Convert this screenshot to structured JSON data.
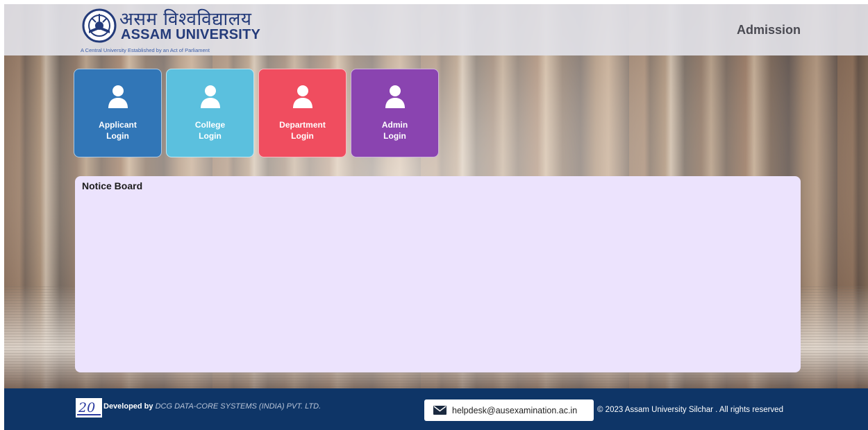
{
  "header": {
    "logo_hindi": "असम विश्वविद्यालय",
    "logo_english": "ASSAM UNIVERSITY",
    "tagline": "A Central University Established by an Act of Parliament",
    "right_title": "Admission"
  },
  "tiles": [
    {
      "label": "Applicant\nLogin",
      "color": "#3176b7",
      "icon": "user-icon"
    },
    {
      "label": "College\nLogin",
      "color": "#5bc0de",
      "icon": "user-icon"
    },
    {
      "label": "Department\nLogin",
      "color": "#f04d5f",
      "icon": "user-icon"
    },
    {
      "label": "Admin\nLogin",
      "color": "#8a44b0",
      "icon": "user-icon"
    }
  ],
  "notice_board": {
    "title": "Notice Board",
    "background": "#ece3fd"
  },
  "footer": {
    "dev_prefix": "Developed by",
    "dev_company": "DCG DATA-CORE SYSTEMS (INDIA) PVT. LTD.",
    "helpdesk_email": "helpdesk@ausexamination.ac.in",
    "copyright": "© 2023 Assam University Silchar . All rights reserved",
    "background": "#0e3567"
  }
}
